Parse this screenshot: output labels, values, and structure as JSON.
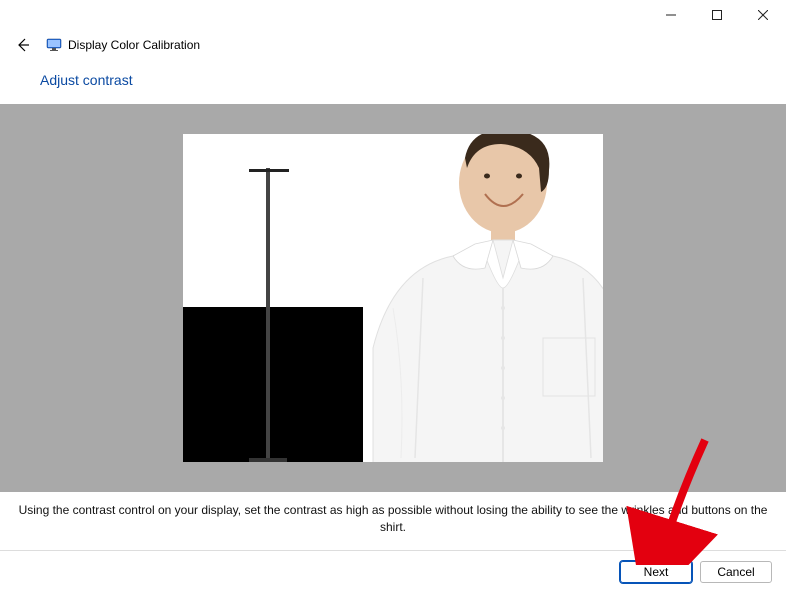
{
  "window": {
    "app_title": "Display Color Calibration",
    "page_heading": "Adjust contrast",
    "instruction": "Using the contrast control on your display, set the contrast as high as possible without losing the ability to see the wrinkles and buttons on the shirt."
  },
  "buttons": {
    "next": "Next",
    "cancel": "Cancel"
  }
}
